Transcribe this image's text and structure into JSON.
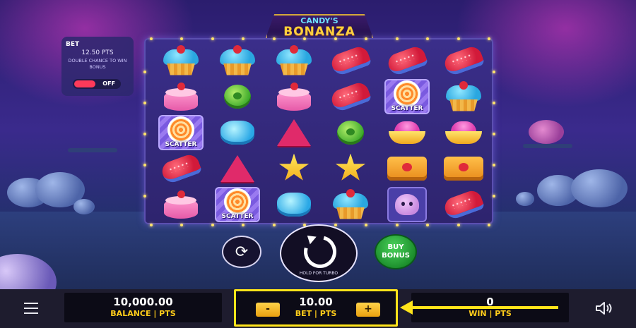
{
  "logo": {
    "line1": "CANDY'S",
    "line2": "BONANZA"
  },
  "bet_panel": {
    "title": "BET",
    "value": "12.50 PTS",
    "description": "DOUBLE CHANCE TO WIN BONUS",
    "toggle_label": "OFF",
    "toggle_state": "off"
  },
  "reels": {
    "rows": [
      [
        "cupcake",
        "cupcake",
        "cupcake",
        "jelly",
        "jelly",
        "jelly"
      ],
      [
        "cake",
        "green",
        "cake",
        "jelly",
        "scatter",
        "cupcake"
      ],
      [
        "scatter",
        "blue",
        "tri",
        "green",
        "pink-bowl",
        "pink-bowl"
      ],
      [
        "jelly",
        "tri",
        "star",
        "star",
        "waffle",
        "waffle"
      ],
      [
        "cake",
        "scatter",
        "blue",
        "cupcake",
        "octo",
        "jelly"
      ]
    ],
    "scatter_label": "SCATTER"
  },
  "controls": {
    "autoplay_icon": "autoplay-icon",
    "spin_hint": "HOLD FOR TURBO",
    "buy_bonus_line1": "BUY",
    "buy_bonus_line2": "BONUS"
  },
  "bottom_bar": {
    "balance_value": "10,000.00",
    "balance_label": "BALANCE | PTS",
    "bet_value": "10.00",
    "bet_label": "BET | PTS",
    "minus_label": "-",
    "plus_label": "+",
    "win_value": "0",
    "win_label": "WIN | PTS"
  },
  "colors": {
    "highlight": "#ffe41a",
    "label_accent": "#ffcc1a",
    "buy_bonus": "#1a8a2a"
  }
}
